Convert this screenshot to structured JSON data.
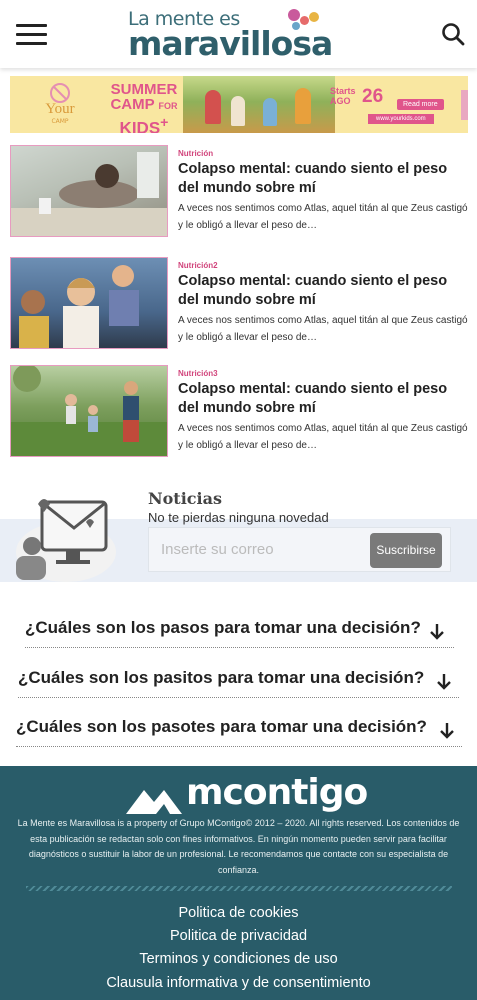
{
  "header": {
    "logo_line1": "La mente es",
    "logo_line2": "maravillosa",
    "menu_icon": "hamburger-menu-icon",
    "search_icon": "search-icon"
  },
  "banner": {
    "badge_text": "Your",
    "badge_sub": "CAMP",
    "camp_line1": "SUMMER",
    "camp_line2": "CAMP",
    "camp_for": "FOR",
    "camp_line3": "KIDS",
    "camp_plus": "+",
    "starts_line1": "Starts",
    "starts_line2": "AGO",
    "date": "26",
    "read_more": "Read more",
    "url": "www.yourkids.com"
  },
  "articles": [
    {
      "category": "Nutrición",
      "title": "Colapso mental: cuando siento el peso del mundo sobre mí",
      "excerpt": "A veces nos sentimos como Atlas, aquel titán al que Zeus castigó y le obligó a llevar el peso de…"
    },
    {
      "category": "Nutrición2",
      "title": "Colapso mental: cuando siento el peso del mundo sobre mí",
      "excerpt": "A veces nos sentimos como Atlas, aquel titán al que Zeus castigó y le obligó a llevar el peso de…"
    },
    {
      "category": "Nutrición3",
      "title": "Colapso mental: cuando siento el peso del mundo sobre mí",
      "excerpt": "A veces nos sentimos como Atlas, aquel titán al que Zeus castigó y le obligó a llevar el peso de…"
    }
  ],
  "newsletter": {
    "title": "Noticias",
    "subtitle": "No te pierdas ninguna novedad",
    "placeholder": "Inserte su correo",
    "button": "Suscribirse"
  },
  "faq": [
    {
      "question": "¿Cuáles son los pasos para tomar una decisión?"
    },
    {
      "question": "¿Cuáles son los pasitos para tomar una decisión?"
    },
    {
      "question": "¿Cuáles son los pasotes para tomar una decisión?"
    }
  ],
  "footer": {
    "logo_text": "mcontigo",
    "legal": "La Mente es Maravillosa is a property of Grupo MContigo© 2012 – 2020. All rights reserved. Los contenidos de esta publicación se redactan solo con fines informativos. En ningún momento pueden servir para facilitar diagnósticos o sustituir la labor de un profesional. Le recomendamos que contacte con su especialista de confianza.",
    "links": [
      "Politica de cookies",
      "Politica de privacidad",
      "Terminos y condiciones de uso",
      "Clausula informativa y de consentimiento"
    ]
  },
  "colors": {
    "brand_teal": "#295c69",
    "accent_pink": "#d1457c",
    "banner_yellow": "#f9e7a1"
  }
}
